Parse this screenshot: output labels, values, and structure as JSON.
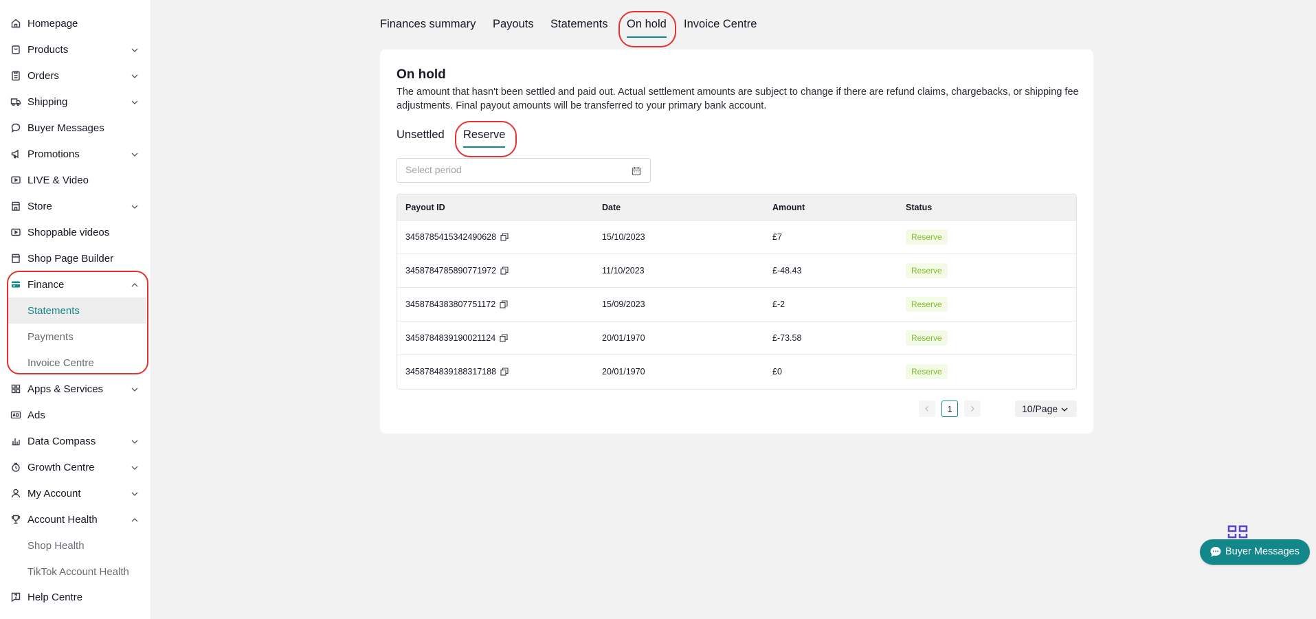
{
  "sidebar": {
    "items": [
      {
        "label": "Homepage",
        "icon": "home-icon",
        "chevron": ""
      },
      {
        "label": "Products",
        "icon": "bag-icon",
        "chevron": "down"
      },
      {
        "label": "Orders",
        "icon": "clipboard-icon",
        "chevron": "down"
      },
      {
        "label": "Shipping",
        "icon": "truck-icon",
        "chevron": "down"
      },
      {
        "label": "Buyer Messages",
        "icon": "chat-icon",
        "chevron": ""
      },
      {
        "label": "Promotions",
        "icon": "megaphone-icon",
        "chevron": "down"
      },
      {
        "label": "LIVE & Video",
        "icon": "live-video-icon",
        "chevron": ""
      },
      {
        "label": "Store",
        "icon": "store-icon",
        "chevron": "down"
      },
      {
        "label": "Shoppable videos",
        "icon": "video-icon",
        "chevron": ""
      },
      {
        "label": "Shop Page Builder",
        "icon": "shop-icon",
        "chevron": ""
      },
      {
        "label": "Finance",
        "icon": "wallet-icon",
        "chevron": "up"
      },
      {
        "label": "Statements",
        "icon": "",
        "chevron": ""
      },
      {
        "label": "Payments",
        "icon": "",
        "chevron": ""
      },
      {
        "label": "Invoice Centre",
        "icon": "",
        "chevron": ""
      },
      {
        "label": "Apps & Services",
        "icon": "apps-icon",
        "chevron": "down"
      },
      {
        "label": "Ads",
        "icon": "ads-icon",
        "chevron": ""
      },
      {
        "label": "Data Compass",
        "icon": "bar-chart-icon",
        "chevron": "down"
      },
      {
        "label": "Growth Centre",
        "icon": "growth-icon",
        "chevron": "down"
      },
      {
        "label": "My Account",
        "icon": "user-icon",
        "chevron": "down"
      },
      {
        "label": "Account Health",
        "icon": "trophy-icon",
        "chevron": "up"
      },
      {
        "label": "Shop Health",
        "icon": "",
        "chevron": ""
      },
      {
        "label": "TikTok Account Health",
        "icon": "",
        "chevron": ""
      },
      {
        "label": "Help Centre",
        "icon": "help-icon",
        "chevron": ""
      }
    ]
  },
  "top_tabs": [
    "Finances summary",
    "Payouts",
    "Statements",
    "On hold",
    "Invoice Centre"
  ],
  "card": {
    "title": "On hold",
    "description": "The amount that hasn't been settled and paid out. Actual settlement amounts are subject to change if there are refund claims, chargebacks, or shipping fee adjustments. Final payout amounts will be transferred to your primary bank account.",
    "sub_tabs": [
      "Unsettled",
      "Reserve"
    ],
    "period_placeholder": "Select period"
  },
  "table": {
    "headers": [
      "Payout ID",
      "Date",
      "Amount",
      "Status"
    ],
    "rows": [
      {
        "id": "3458785415342490628",
        "date": "15/10/2023",
        "amount": "£7",
        "status": "Reserve"
      },
      {
        "id": "3458784785890771972",
        "date": "11/10/2023",
        "amount": "£-48.43",
        "status": "Reserve"
      },
      {
        "id": "3458784383807751172",
        "date": "15/09/2023",
        "amount": "£-2",
        "status": "Reserve"
      },
      {
        "id": "3458784839190021124",
        "date": "20/01/1970",
        "amount": "£-73.58",
        "status": "Reserve"
      },
      {
        "id": "3458784839188317188",
        "date": "20/01/1970",
        "amount": "£0",
        "status": "Reserve"
      }
    ]
  },
  "pagination": {
    "current_page": "1",
    "page_size": "10/Page"
  },
  "fab": {
    "label": "Buyer Messages"
  },
  "colors": {
    "accent": "#13888a",
    "highlight": "#e8302f",
    "status_text": "#7dbd29",
    "status_bg": "#f3fbe6"
  }
}
